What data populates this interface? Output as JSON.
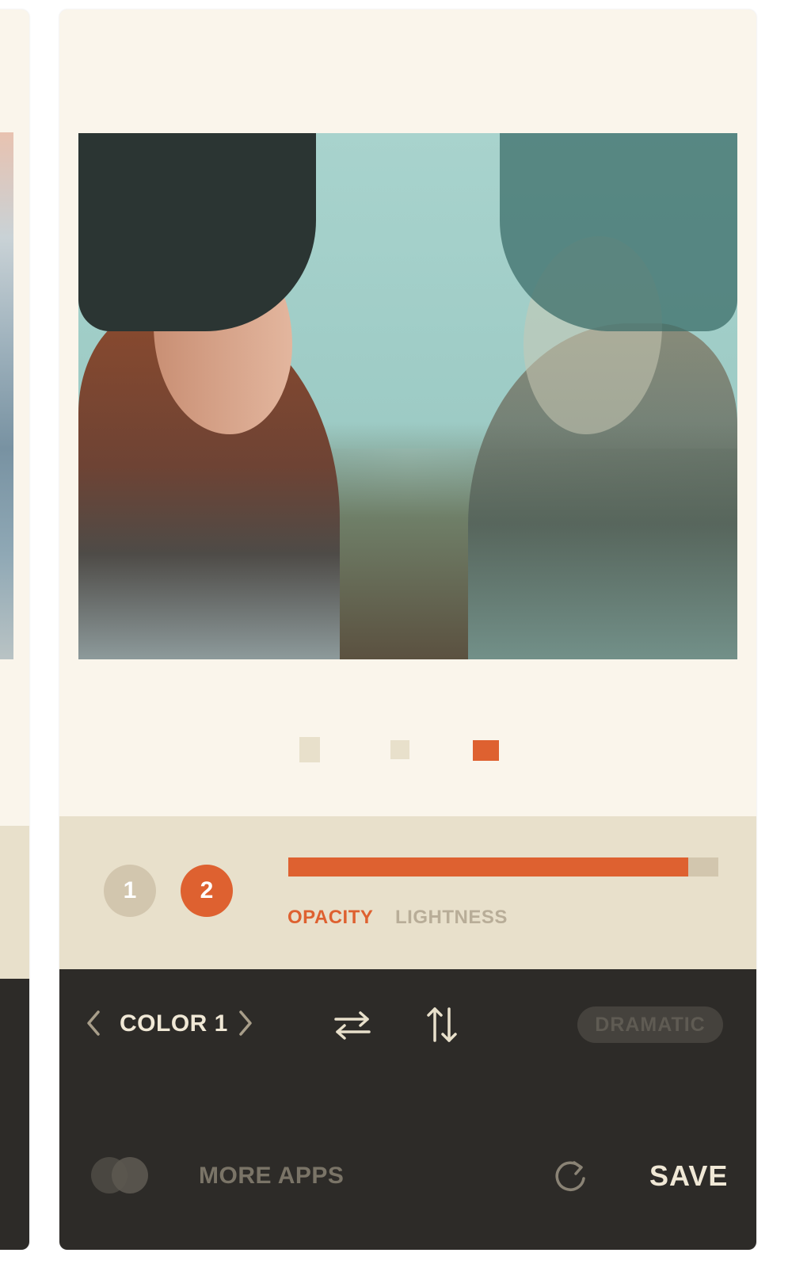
{
  "pager": {
    "count": 3,
    "active_index": 2
  },
  "layers": {
    "items": [
      "1",
      "2"
    ],
    "selected": "2"
  },
  "slider": {
    "value_fraction": 0.93
  },
  "params": {
    "opacity_label": "OPACITY",
    "lightness_label": "LIGHTNESS",
    "active": "OPACITY"
  },
  "toolbar": {
    "prev_icon": "chevron-left-icon",
    "color_label": "COLOR 1",
    "next_icon": "chevron-right-icon",
    "swap_horizontal_icon": "swap-horizontal-icon",
    "swap_vertical_icon": "swap-vertical-icon",
    "preset_label": "DRAMATIC"
  },
  "footer": {
    "more_apps_label": "MORE APPS",
    "refresh_icon": "refresh-icon",
    "save_label": "SAVE"
  },
  "colors": {
    "accent": "#de6130",
    "panel": "#e8e0cb",
    "dark": "#2d2b28",
    "card": "#faf5eb"
  }
}
